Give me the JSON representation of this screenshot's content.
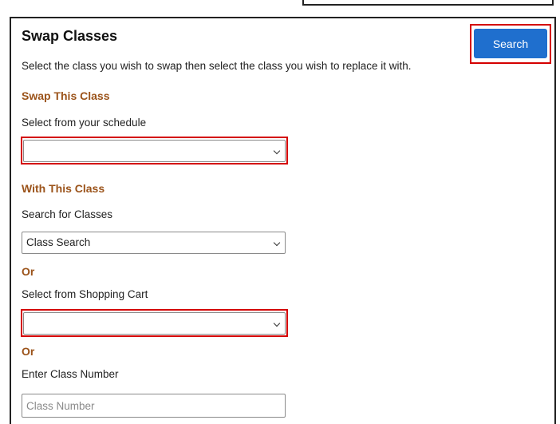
{
  "panel": {
    "title": "Swap Classes",
    "search_label": "Search",
    "description": "Select the class you wish to swap then select the class you wish to replace it with."
  },
  "swap_this": {
    "heading": "Swap This Class",
    "schedule_label": "Select from your schedule",
    "schedule_value": ""
  },
  "with_this": {
    "heading": "With This Class",
    "search_label": "Search for Classes",
    "search_value": "Class Search",
    "or_1": "Or",
    "cart_label": "Select from Shopping Cart",
    "cart_value": "",
    "or_2": "Or",
    "number_label": "Enter Class Number",
    "number_placeholder": "Class Number"
  },
  "colors": {
    "accent": "#1f6fce",
    "section_heading": "#9b531a",
    "highlight": "#d40000"
  }
}
